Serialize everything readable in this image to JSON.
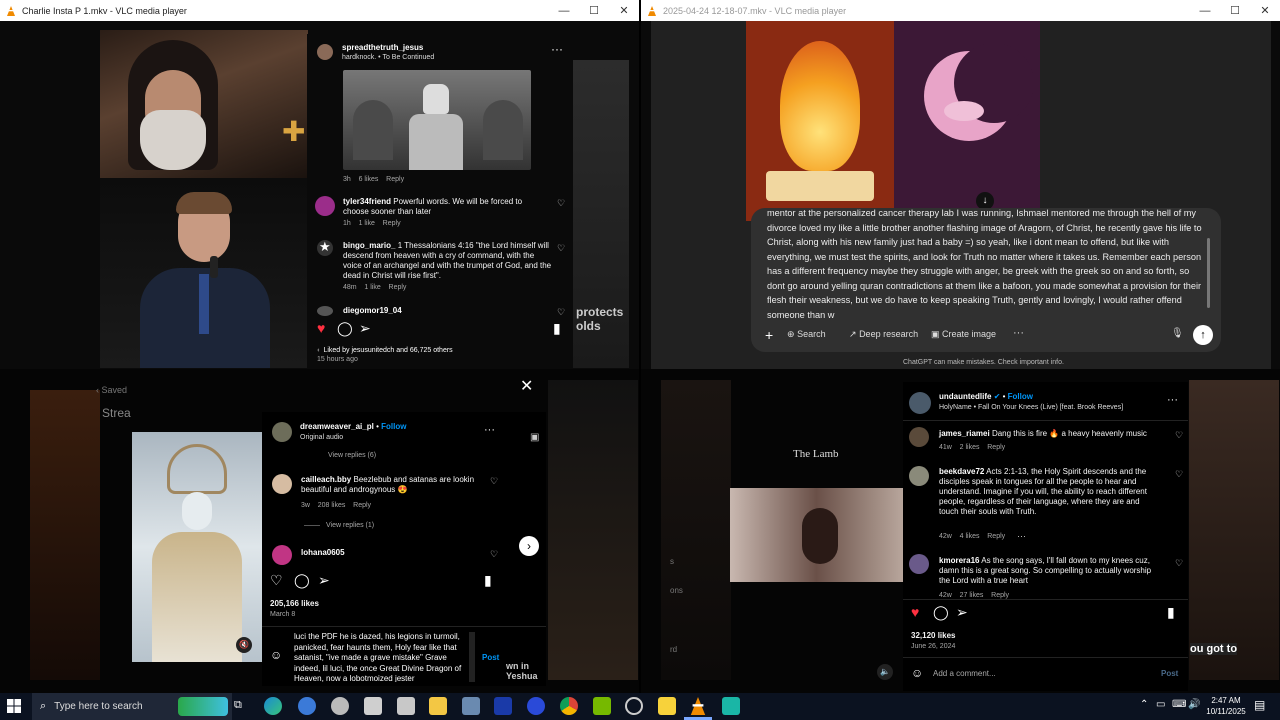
{
  "windows": {
    "left_title": "Charlie Insta P 1.mkv - VLC media player",
    "right_title": "2025-04-24 12-18-07.mkv - VLC media player"
  },
  "post1": {
    "top_user": "spreadthetruth_jesus",
    "top_sub": "hardknock. • To Be Continued",
    "top_meta": "3h    6 likes    Reply",
    "comments": [
      {
        "user": "tyler34friend",
        "text": "Powerful words. We will be forced to choose sooner than later",
        "meta": "1h    1 like    Reply"
      },
      {
        "user": "bingo_mario_",
        "text": "1 Thessalonians 4:16 \"the Lord himself will descend from heaven with a cry of command, with the voice of an archangel and with the trumpet of God, and the dead in Christ will rise first\".",
        "meta": "48m    1 like    Reply"
      },
      {
        "user": "diegomor19_04",
        "text": "",
        "meta": ""
      }
    ],
    "liked_by": "Liked by jesusunitedch and 66,725 others",
    "time_ago": "15 hours ago",
    "bg_text": "protects olds"
  },
  "chatgpt": {
    "message": "mentor at the personalized cancer therapy lab I was running, Ishmael mentored me through the hell of my divorce loved my like a little brother another flashing image of Aragorn, of Christ, he recently gave his life to Christ, along with his new family just had a baby =) so yeah, like i dont mean to offend, but like with everything, we must test the spirits, and look for Truth no matter where it takes us. Remember each person has a different frequency maybe they struggle with anger, be greek with the greek so on and so forth,  so dont go around yelling quran contradictions at them like a bafoon, you made somewhat a provision for their flesh their weakness, but we do have to keep speaking Truth, gently and lovingly, I would rather offend someone than w",
    "buttons": [
      "Search",
      "Deep research",
      "Create image"
    ],
    "disclaimer": "ChatGPT can make mistakes. Check important info."
  },
  "post2": {
    "saved_label": "Saved",
    "stream_label": "Strea",
    "user": "dreamweaver_ai_pl",
    "follow": "Follow",
    "audio": "Original audio",
    "view_replies_top": "View replies (6)",
    "comments": [
      {
        "user": "cailleach.bby",
        "text": "Beezlebub and satanas are lookin beautiful and androgynous 😍",
        "meta": "3w    208 likes    Reply"
      },
      {
        "user": "lohana0605",
        "text": "",
        "meta": ""
      }
    ],
    "view_replies": "View replies (1)",
    "likes": "205,166 likes",
    "date": "March 8",
    "draft": "luci the PDF he is dazed, his legions in turmoil, panicked, fear haunts them, Holy fear like that satanist, \"ive made a grave mistake\" Grave indeed, lil luci, the once Great Divine Dragon of Heaven, now a lobotmoized jester",
    "post_btn": "Post",
    "bg_text": "wn in Yeshua"
  },
  "post3": {
    "bg_title": "The Lamb",
    "user": "undauntedlife",
    "follow": "Follow",
    "audio": "HolyName • Fall On Your Knees (Live) [feat. Brook Reeves]",
    "comments": [
      {
        "user": "james_riamei",
        "text": "Dang this is fire 🔥 a heavy heavenly music",
        "meta": "41w    2 likes    Reply"
      },
      {
        "user": "beekdave72",
        "text": "Acts 2:1-13, the Holy Spirit descends and the disciples speak in tongues for all the people to hear and understand. Imagine if you will, the ability to reach different people, regardless of their language, where they are and touch their souls with Truth.",
        "meta": "42w    4 likes    Reply"
      },
      {
        "user": "kmorera16",
        "text": "As the song says, I'll fall down to my knees cuz, damn this is a great song. So compelling to actually worship the Lord with a true heart",
        "meta": "42w    27 likes    Reply"
      }
    ],
    "likes": "32,120 likes",
    "date": "June 26, 2024",
    "add_comment": "Add a comment...",
    "post_btn": "Post",
    "side_s": "s",
    "side_ons": "ons",
    "side_rd": "rd",
    "bg_text": "ou got to"
  },
  "taskbar": {
    "search_placeholder": "Type here to search",
    "time": "2:47 AM",
    "date": "10/11/2025"
  },
  "colors": {
    "vlc_orange": "#f08a00",
    "ig_blue": "#0095f6",
    "like_red": "#ff3040",
    "taskbar": "#0b1220"
  }
}
